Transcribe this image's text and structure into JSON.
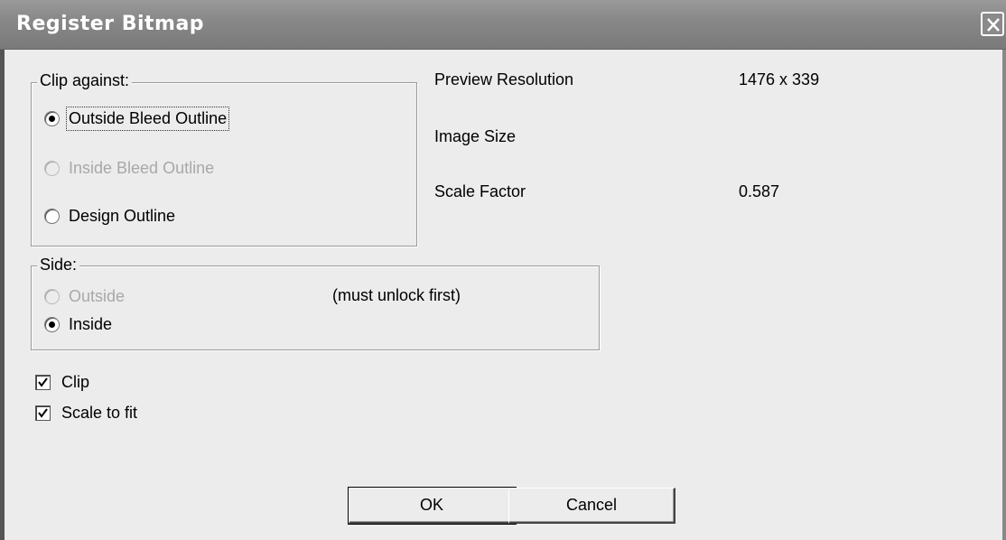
{
  "window": {
    "title": "Register Bitmap"
  },
  "clip_against": {
    "legend": "Clip against:",
    "options": [
      {
        "label": "Outside Bleed Outline",
        "checked": true,
        "enabled": true
      },
      {
        "label": "Inside Bleed Outline",
        "checked": false,
        "enabled": false
      },
      {
        "label": "Design Outline",
        "checked": false,
        "enabled": true
      }
    ]
  },
  "info": {
    "preview_resolution_label": "Preview Resolution",
    "preview_resolution_value": "1476 x 339",
    "image_size_label": "Image Size",
    "image_size_value": "",
    "scale_factor_label": "Scale Factor",
    "scale_factor_value": "0.587"
  },
  "side": {
    "legend": "Side:",
    "options": [
      {
        "label": "Outside",
        "checked": false,
        "enabled": false
      },
      {
        "label": "Inside",
        "checked": true,
        "enabled": true
      }
    ],
    "note": "(must unlock first)"
  },
  "checkboxes": {
    "clip_label": "Clip",
    "clip_checked": true,
    "scale_label": "Scale to fit",
    "scale_checked": true
  },
  "buttons": {
    "ok_label": "OK",
    "cancel_label": "Cancel"
  }
}
